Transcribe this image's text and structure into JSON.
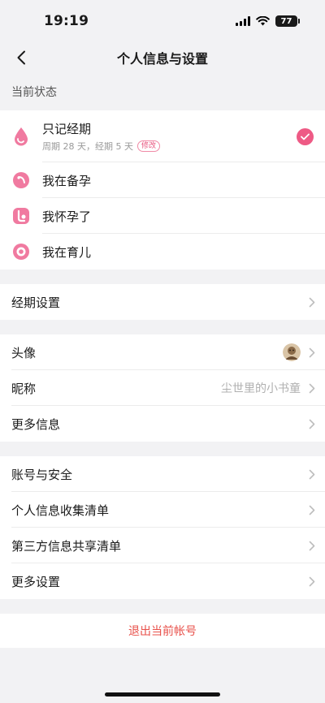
{
  "status_bar": {
    "time": "19:19",
    "battery": "77"
  },
  "nav": {
    "title": "个人信息与设置"
  },
  "current_status": {
    "label": "当前状态",
    "items": [
      {
        "title": "只记经期",
        "subtitle": "周期 28 天，经期 5 天",
        "badge": "修改",
        "selected": true
      },
      {
        "title": "我在备孕"
      },
      {
        "title": "我怀孕了"
      },
      {
        "title": "我在育儿"
      }
    ]
  },
  "period_settings": {
    "label": "经期设置"
  },
  "profile": {
    "avatar_label": "头像",
    "nickname_label": "昵称",
    "nickname_value": "尘世里的小书童",
    "more_info_label": "更多信息"
  },
  "account": {
    "security_label": "账号与安全",
    "personal_info_label": "个人信息收集清单",
    "third_party_label": "第三方信息共享清单",
    "more_settings_label": "更多设置"
  },
  "logout": {
    "label": "退出当前帐号"
  },
  "colors": {
    "accent": "#ee5a85",
    "logout": "#e8504a",
    "background": "#f2f2f4"
  }
}
